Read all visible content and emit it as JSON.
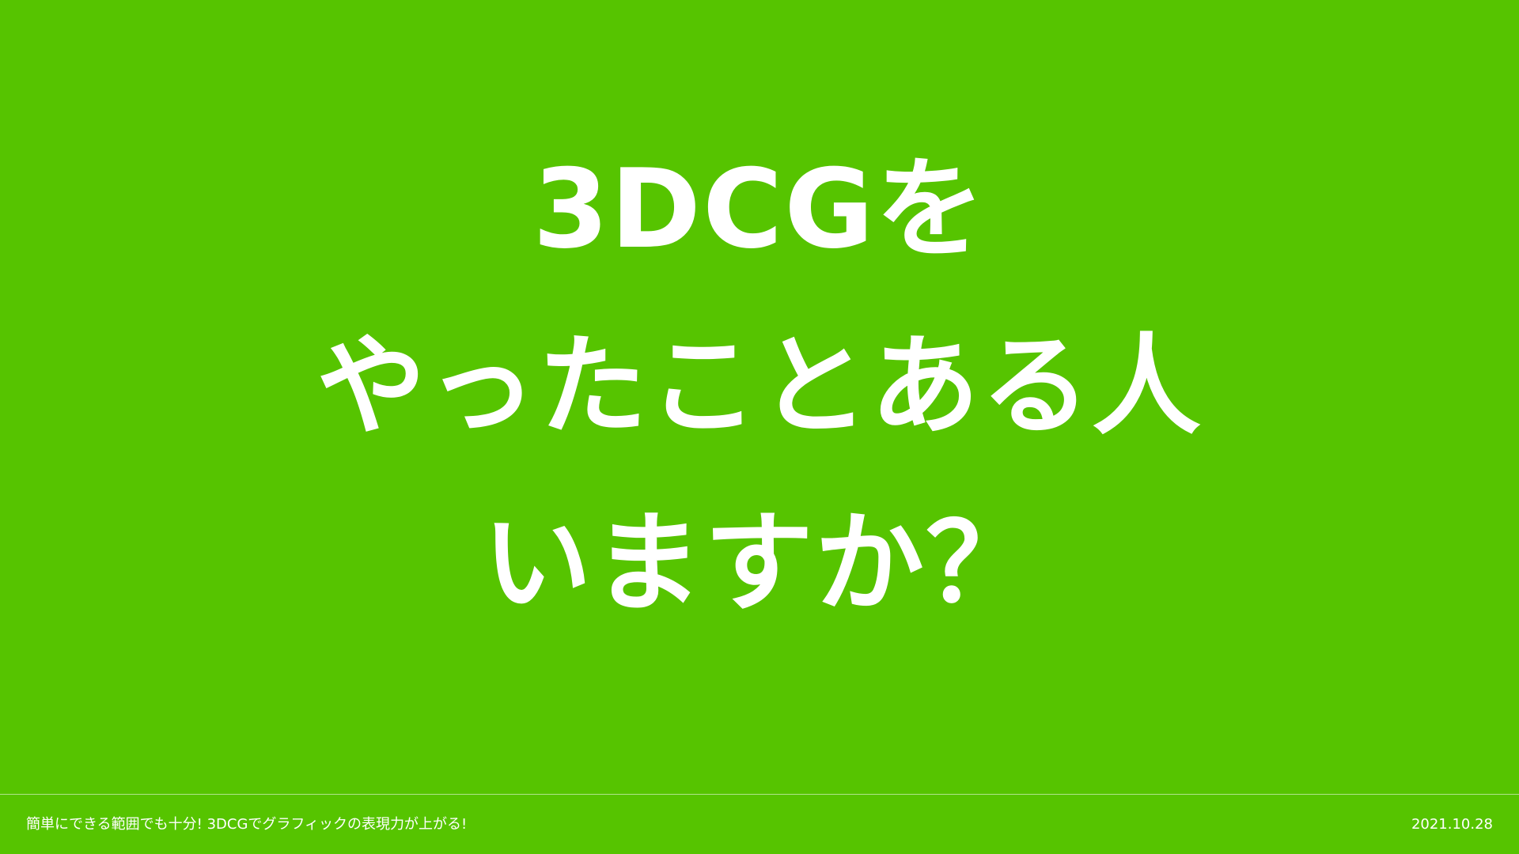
{
  "slide": {
    "headline": {
      "line1": "3DCGを",
      "line2": "やったことある人",
      "line3": "いますか？"
    },
    "footer": {
      "title": "簡単にできる範囲でも十分! 3DCGでグラフィックの表現力が上がる!",
      "date": "2021.10.28"
    },
    "colors": {
      "background": "#56c400",
      "text": "#ffffff"
    }
  }
}
